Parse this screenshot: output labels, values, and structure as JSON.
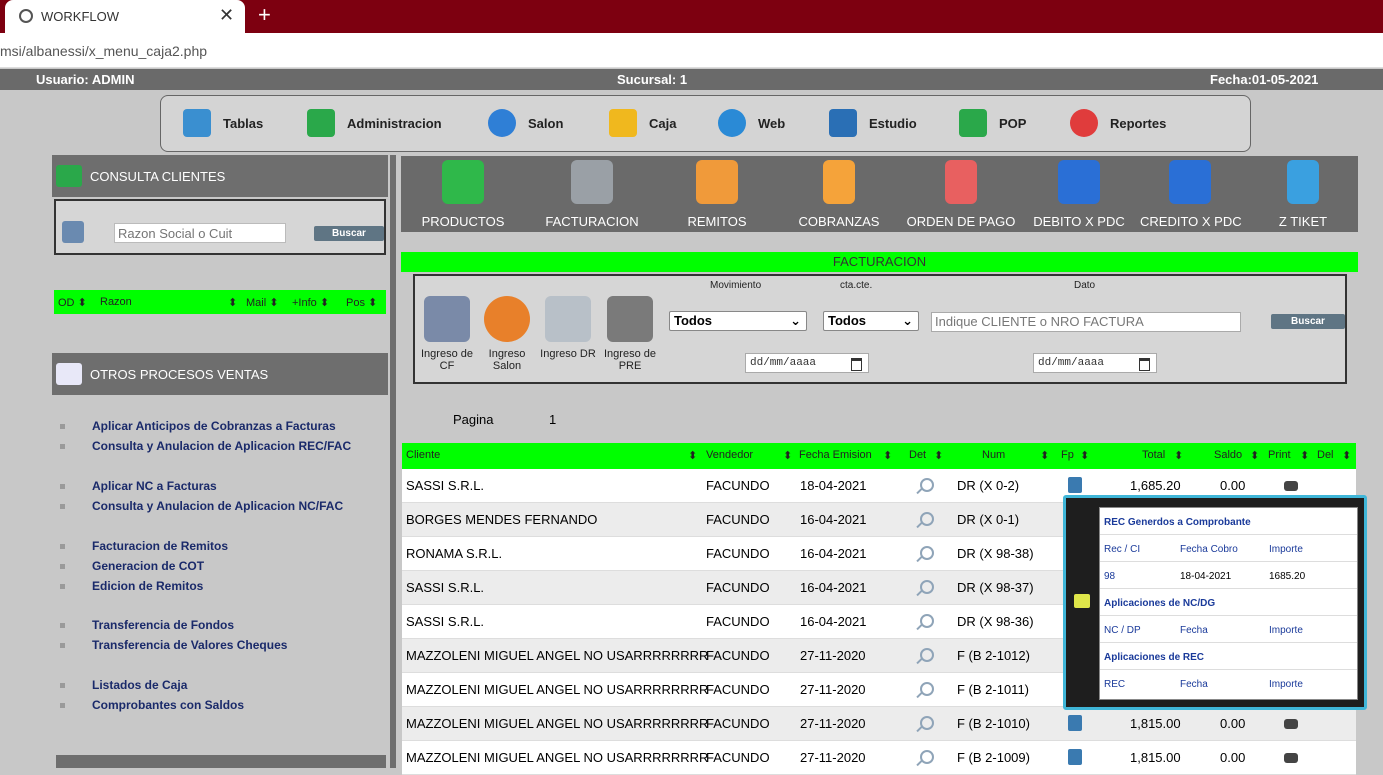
{
  "browser": {
    "tab_title": "WORKFLOW",
    "url": "msi/albanessi/x_menu_caja2.php",
    "new_tab": "+",
    "close": "✕"
  },
  "status": {
    "usuario": "Usuario: ADMIN",
    "sucursal": "Sucursal: 1",
    "fecha": "Fecha:01-05-2021"
  },
  "menu": [
    {
      "label": "Tablas",
      "icon": "tables-icon",
      "color": "#3a8fd0"
    },
    {
      "label": "Administracion",
      "icon": "check-board-icon",
      "color": "#2aa84a"
    },
    {
      "label": "Salon",
      "icon": "globe-icon",
      "color": "#2f7fd6"
    },
    {
      "label": "Caja",
      "icon": "cash-box-icon",
      "color": "#f0b81e"
    },
    {
      "label": "Web",
      "icon": "web-search-icon",
      "color": "#2a8ad6"
    },
    {
      "label": "Estudio",
      "icon": "book-icon",
      "color": "#2a6fb5"
    },
    {
      "label": "POP",
      "icon": "users-icon",
      "color": "#2aa84a"
    },
    {
      "label": "Reportes",
      "icon": "pie-chart-icon",
      "color": "#e03c3c"
    }
  ],
  "left": {
    "consulta_title": "CONSULTA CLIENTES",
    "search_placeholder": "Razon Social o Cuit",
    "search_button": "Buscar",
    "table_headers": {
      "od": "OD ⬍",
      "razon": "Razon",
      "sort": "⬍",
      "mail": "Mail ⬍",
      "info": "+Info ⬍",
      "pos": "Pos ⬍"
    },
    "otros_title": "OTROS PROCESOS VENTAS",
    "links": [
      [
        "Aplicar Anticipos de Cobranzas a Facturas",
        "Consulta y Anulacion de Aplicacion REC/FAC"
      ],
      [
        "Aplicar NC a Facturas",
        "Consulta y Anulacion de Aplicacion NC/FAC"
      ],
      [
        "Facturacion de Remitos",
        "Generacion de COT",
        "Edicion de Remitos"
      ],
      [
        "Transferencia de Fondos",
        "Transferencia de Valores Cheques"
      ],
      [
        "Listados de Caja",
        "Comprobantes con Saldos"
      ]
    ]
  },
  "iconbar": [
    {
      "label": "PRODUCTOS",
      "icon": "cubes-icon",
      "color": "#2fb84a"
    },
    {
      "label": "FACTURACION",
      "icon": "database-add-icon",
      "color": "#9aa0a6"
    },
    {
      "label": "REMITOS",
      "icon": "package-icon",
      "color": "#f09a3a"
    },
    {
      "label": "COBRANZAS",
      "icon": "orange-folder-icon",
      "color": "#f5a33a"
    },
    {
      "label": "ORDEN DE PAGO",
      "icon": "red-folder-icon",
      "color": "#e86060"
    },
    {
      "label": "DEBITO X PDC",
      "icon": "debit-book-icon",
      "color": "#2a6fd6"
    },
    {
      "label": "CREDITO X PDC",
      "icon": "credit-book-icon",
      "color": "#2a6fd6"
    },
    {
      "label": "Z TIKET",
      "icon": "blue-folder-icon",
      "color": "#3aa0e0"
    }
  ],
  "facturacion": {
    "title": "FACTURACION",
    "icons": [
      {
        "label_1": "Ingreso de",
        "label_2": "CF",
        "icon": "tools-icon"
      },
      {
        "label_1": "Ingreso",
        "label_2": "Salon",
        "icon": "browser-icon"
      },
      {
        "label_1": "Ingreso DR",
        "label_2": "",
        "icon": "pen-icon"
      },
      {
        "label_1": "Ingreso de",
        "label_2": "PRE",
        "icon": "gears-icon"
      }
    ],
    "movimiento_label": "Movimiento",
    "ctacte_label": "cta.cte.",
    "dato_label": "Dato",
    "movimiento_value": "Todos",
    "ctacte_value": "Todos",
    "dato_placeholder": "Indique CLIENTE o NRO FACTURA",
    "buscar": "Buscar",
    "date_placeholder": "dd/mm/aaaa"
  },
  "pagina": {
    "label": "Pagina",
    "value": "1"
  },
  "table": {
    "headers": {
      "cliente": "Cliente",
      "vendedor": "Vendedor",
      "fecha": "Fecha Emision",
      "det": "Det",
      "num": "Num",
      "fp": "Fp",
      "total": "Total",
      "saldo": "Saldo",
      "print": "Print",
      "del": "Del",
      "sort": "⬍"
    },
    "rows": [
      {
        "cliente": "SASSI S.R.L.",
        "vendedor": "FACUNDO",
        "fecha": "18-04-2021",
        "num": "DR (X 0-2)",
        "total": "1,685.20",
        "saldo": "0.00"
      },
      {
        "cliente": "BORGES MENDES FERNANDO",
        "vendedor": "FACUNDO",
        "fecha": "16-04-2021",
        "num": "DR (X 0-1)",
        "total": "",
        "saldo": ""
      },
      {
        "cliente": "RONAMA S.R.L.",
        "vendedor": "FACUNDO",
        "fecha": "16-04-2021",
        "num": "DR (X 98-38)",
        "total": "",
        "saldo": ""
      },
      {
        "cliente": "SASSI S.R.L.",
        "vendedor": "FACUNDO",
        "fecha": "16-04-2021",
        "num": "DR (X 98-37)",
        "total": "",
        "saldo": ""
      },
      {
        "cliente": "SASSI S.R.L.",
        "vendedor": "FACUNDO",
        "fecha": "16-04-2021",
        "num": "DR (X 98-36)",
        "total": "",
        "saldo": ""
      },
      {
        "cliente": "MAZZOLENI MIGUEL ANGEL NO USARRRRRRRR",
        "vendedor": "FACUNDO",
        "fecha": "27-11-2020",
        "num": "F (B 2-1012)",
        "total": "",
        "saldo": ""
      },
      {
        "cliente": "MAZZOLENI MIGUEL ANGEL NO USARRRRRRRR",
        "vendedor": "FACUNDO",
        "fecha": "27-11-2020",
        "num": "F (B 2-1011)",
        "total": "",
        "saldo": ""
      },
      {
        "cliente": "MAZZOLENI MIGUEL ANGEL NO USARRRRRRRR",
        "vendedor": "FACUNDO",
        "fecha": "27-11-2020",
        "num": "F (B 2-1010)",
        "total": "1,815.00",
        "saldo": "0.00"
      },
      {
        "cliente": "MAZZOLENI MIGUEL ANGEL NO USARRRRRRRR",
        "vendedor": "FACUNDO",
        "fecha": "27-11-2020",
        "num": "F (B 2-1009)",
        "total": "1,815.00",
        "saldo": "0.00"
      }
    ]
  },
  "popup": {
    "rec_title": "REC Generdos a Comprobante",
    "rec_cols": {
      "a": "Rec / CI",
      "b": "Fecha Cobro",
      "c": "Importe"
    },
    "rec_row": {
      "a": "98",
      "b": "18-04-2021",
      "c": "1685.20"
    },
    "nc_title": "Aplicaciones de NC/DG",
    "nc_cols": {
      "a": "NC / DP",
      "b": "Fecha",
      "c": "Importe"
    },
    "aprec_title": "Aplicaciones de REC",
    "aprec_cols": {
      "a": "REC",
      "b": "Fecha",
      "c": "Importe"
    }
  }
}
